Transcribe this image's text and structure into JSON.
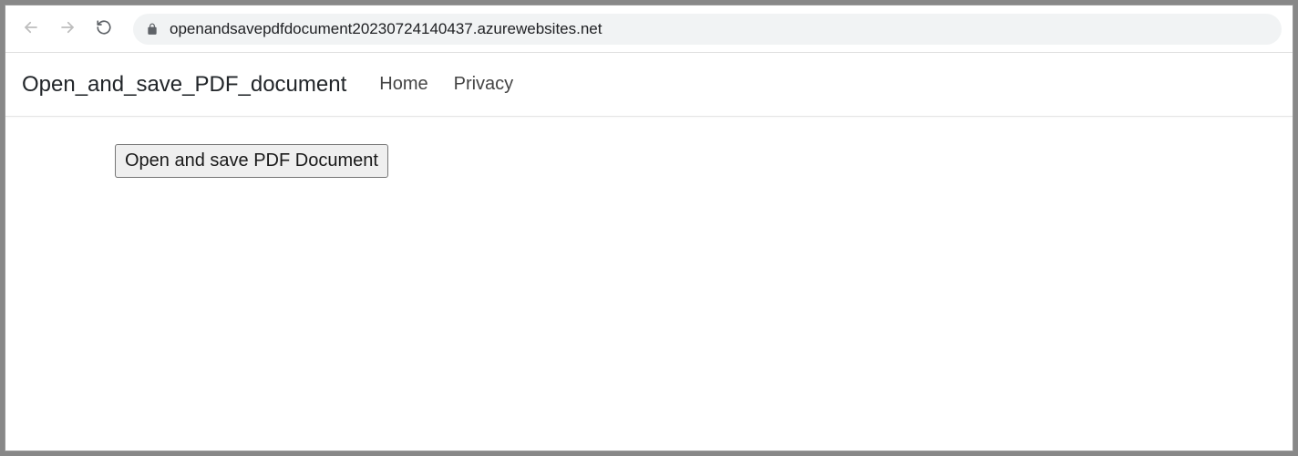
{
  "browser": {
    "url": "openandsavepdfdocument20230724140437.azurewebsites.net"
  },
  "navbar": {
    "brand": "Open_and_save_PDF_document",
    "links": [
      {
        "label": "Home"
      },
      {
        "label": "Privacy"
      }
    ]
  },
  "main": {
    "button_label": "Open and save PDF Document"
  }
}
